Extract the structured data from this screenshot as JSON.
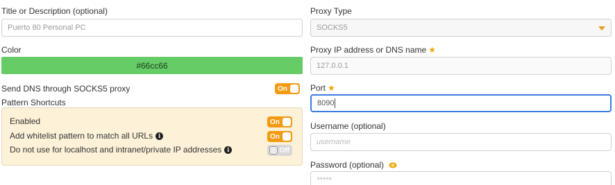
{
  "left": {
    "title_label": "Title or Description (optional)",
    "title_value": "Puerto 80 Personal PC",
    "color_label": "Color",
    "color_value": "#66cc66",
    "dns_label": "Send DNS through SOCKS5 proxy",
    "dns_toggle": "On",
    "pattern_label": "Pattern Shortcuts",
    "patterns": [
      {
        "label": "Enabled",
        "toggle": "On",
        "info": false
      },
      {
        "label": "Add whitelist pattern to match all URLs",
        "toggle": "On",
        "info": true
      },
      {
        "label": "Do not use for localhost and intranet/private IP addresses",
        "toggle": "Off",
        "info": true
      }
    ]
  },
  "right": {
    "proxy_type_label": "Proxy Type",
    "proxy_type_value": "SOCKS5",
    "proxy_ip_label": "Proxy IP address or DNS name",
    "proxy_ip_placeholder": "127.0.0.1",
    "port_label": "Port",
    "port_value": "8090",
    "username_label": "Username (optional)",
    "username_placeholder": "username",
    "password_label": "Password (optional)",
    "password_placeholder": "*****"
  },
  "colors": {
    "accent": "#f29b12",
    "focus": "#3d7be0",
    "pattern_bg": "#fdf1d8"
  },
  "icons": {
    "required": "star-icon",
    "info": "info-icon",
    "reveal_password": "eye-icon"
  }
}
